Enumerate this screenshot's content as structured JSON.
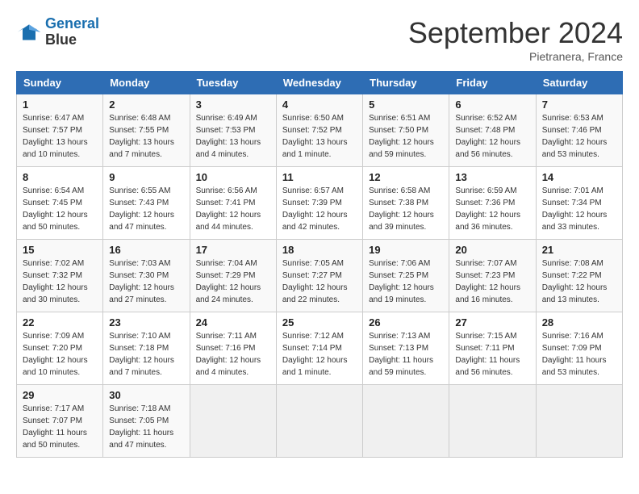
{
  "header": {
    "logo_line1": "General",
    "logo_line2": "Blue",
    "month_title": "September 2024",
    "subtitle": "Pietranera, France"
  },
  "columns": [
    "Sunday",
    "Monday",
    "Tuesday",
    "Wednesday",
    "Thursday",
    "Friday",
    "Saturday"
  ],
  "rows": [
    [
      {
        "num": "1",
        "sunrise": "Sunrise: 6:47 AM",
        "sunset": "Sunset: 7:57 PM",
        "daylight": "Daylight: 13 hours and 10 minutes."
      },
      {
        "num": "2",
        "sunrise": "Sunrise: 6:48 AM",
        "sunset": "Sunset: 7:55 PM",
        "daylight": "Daylight: 13 hours and 7 minutes."
      },
      {
        "num": "3",
        "sunrise": "Sunrise: 6:49 AM",
        "sunset": "Sunset: 7:53 PM",
        "daylight": "Daylight: 13 hours and 4 minutes."
      },
      {
        "num": "4",
        "sunrise": "Sunrise: 6:50 AM",
        "sunset": "Sunset: 7:52 PM",
        "daylight": "Daylight: 13 hours and 1 minute."
      },
      {
        "num": "5",
        "sunrise": "Sunrise: 6:51 AM",
        "sunset": "Sunset: 7:50 PM",
        "daylight": "Daylight: 12 hours and 59 minutes."
      },
      {
        "num": "6",
        "sunrise": "Sunrise: 6:52 AM",
        "sunset": "Sunset: 7:48 PM",
        "daylight": "Daylight: 12 hours and 56 minutes."
      },
      {
        "num": "7",
        "sunrise": "Sunrise: 6:53 AM",
        "sunset": "Sunset: 7:46 PM",
        "daylight": "Daylight: 12 hours and 53 minutes."
      }
    ],
    [
      {
        "num": "8",
        "sunrise": "Sunrise: 6:54 AM",
        "sunset": "Sunset: 7:45 PM",
        "daylight": "Daylight: 12 hours and 50 minutes."
      },
      {
        "num": "9",
        "sunrise": "Sunrise: 6:55 AM",
        "sunset": "Sunset: 7:43 PM",
        "daylight": "Daylight: 12 hours and 47 minutes."
      },
      {
        "num": "10",
        "sunrise": "Sunrise: 6:56 AM",
        "sunset": "Sunset: 7:41 PM",
        "daylight": "Daylight: 12 hours and 44 minutes."
      },
      {
        "num": "11",
        "sunrise": "Sunrise: 6:57 AM",
        "sunset": "Sunset: 7:39 PM",
        "daylight": "Daylight: 12 hours and 42 minutes."
      },
      {
        "num": "12",
        "sunrise": "Sunrise: 6:58 AM",
        "sunset": "Sunset: 7:38 PM",
        "daylight": "Daylight: 12 hours and 39 minutes."
      },
      {
        "num": "13",
        "sunrise": "Sunrise: 6:59 AM",
        "sunset": "Sunset: 7:36 PM",
        "daylight": "Daylight: 12 hours and 36 minutes."
      },
      {
        "num": "14",
        "sunrise": "Sunrise: 7:01 AM",
        "sunset": "Sunset: 7:34 PM",
        "daylight": "Daylight: 12 hours and 33 minutes."
      }
    ],
    [
      {
        "num": "15",
        "sunrise": "Sunrise: 7:02 AM",
        "sunset": "Sunset: 7:32 PM",
        "daylight": "Daylight: 12 hours and 30 minutes."
      },
      {
        "num": "16",
        "sunrise": "Sunrise: 7:03 AM",
        "sunset": "Sunset: 7:30 PM",
        "daylight": "Daylight: 12 hours and 27 minutes."
      },
      {
        "num": "17",
        "sunrise": "Sunrise: 7:04 AM",
        "sunset": "Sunset: 7:29 PM",
        "daylight": "Daylight: 12 hours and 24 minutes."
      },
      {
        "num": "18",
        "sunrise": "Sunrise: 7:05 AM",
        "sunset": "Sunset: 7:27 PM",
        "daylight": "Daylight: 12 hours and 22 minutes."
      },
      {
        "num": "19",
        "sunrise": "Sunrise: 7:06 AM",
        "sunset": "Sunset: 7:25 PM",
        "daylight": "Daylight: 12 hours and 19 minutes."
      },
      {
        "num": "20",
        "sunrise": "Sunrise: 7:07 AM",
        "sunset": "Sunset: 7:23 PM",
        "daylight": "Daylight: 12 hours and 16 minutes."
      },
      {
        "num": "21",
        "sunrise": "Sunrise: 7:08 AM",
        "sunset": "Sunset: 7:22 PM",
        "daylight": "Daylight: 12 hours and 13 minutes."
      }
    ],
    [
      {
        "num": "22",
        "sunrise": "Sunrise: 7:09 AM",
        "sunset": "Sunset: 7:20 PM",
        "daylight": "Daylight: 12 hours and 10 minutes."
      },
      {
        "num": "23",
        "sunrise": "Sunrise: 7:10 AM",
        "sunset": "Sunset: 7:18 PM",
        "daylight": "Daylight: 12 hours and 7 minutes."
      },
      {
        "num": "24",
        "sunrise": "Sunrise: 7:11 AM",
        "sunset": "Sunset: 7:16 PM",
        "daylight": "Daylight: 12 hours and 4 minutes."
      },
      {
        "num": "25",
        "sunrise": "Sunrise: 7:12 AM",
        "sunset": "Sunset: 7:14 PM",
        "daylight": "Daylight: 12 hours and 1 minute."
      },
      {
        "num": "26",
        "sunrise": "Sunrise: 7:13 AM",
        "sunset": "Sunset: 7:13 PM",
        "daylight": "Daylight: 11 hours and 59 minutes."
      },
      {
        "num": "27",
        "sunrise": "Sunrise: 7:15 AM",
        "sunset": "Sunset: 7:11 PM",
        "daylight": "Daylight: 11 hours and 56 minutes."
      },
      {
        "num": "28",
        "sunrise": "Sunrise: 7:16 AM",
        "sunset": "Sunset: 7:09 PM",
        "daylight": "Daylight: 11 hours and 53 minutes."
      }
    ],
    [
      {
        "num": "29",
        "sunrise": "Sunrise: 7:17 AM",
        "sunset": "Sunset: 7:07 PM",
        "daylight": "Daylight: 11 hours and 50 minutes."
      },
      {
        "num": "30",
        "sunrise": "Sunrise: 7:18 AM",
        "sunset": "Sunset: 7:05 PM",
        "daylight": "Daylight: 11 hours and 47 minutes."
      },
      null,
      null,
      null,
      null,
      null
    ]
  ]
}
